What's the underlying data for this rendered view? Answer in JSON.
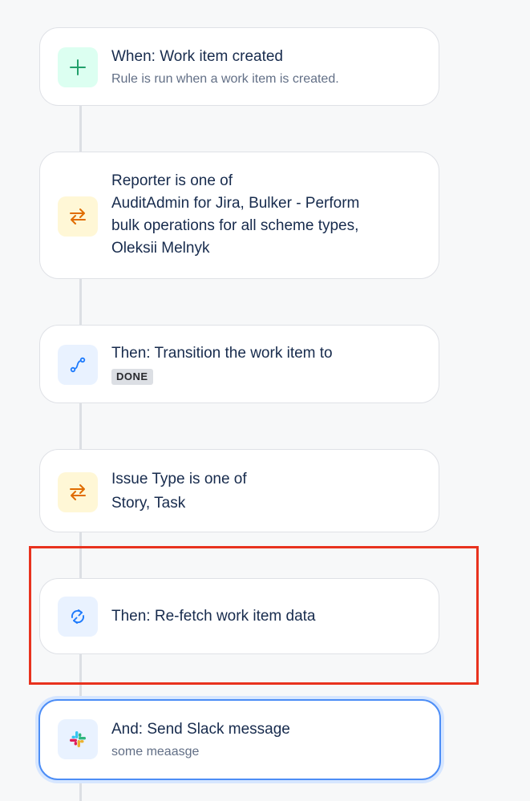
{
  "steps": [
    {
      "kind": "trigger",
      "icon": "plus-icon",
      "title": "When: Work item created",
      "description": "Rule is run when a work item is created."
    },
    {
      "kind": "condition",
      "icon": "condition-arrows-icon",
      "title_lines": [
        "Reporter is one of",
        "AuditAdmin for Jira, Bulker - Perform",
        "bulk operations for all scheme types,",
        "Oleksii Melnyk"
      ]
    },
    {
      "kind": "action",
      "icon": "transition-icon",
      "title": "Then: Transition the work item to",
      "status_lozenge": "DONE"
    },
    {
      "kind": "condition",
      "icon": "condition-arrows-icon",
      "title_lines": [
        "Issue Type is one of",
        "Story, Task"
      ]
    },
    {
      "kind": "action",
      "icon": "refresh-icon",
      "title": "Then: Re-fetch work item data",
      "highlighted": true
    },
    {
      "kind": "action",
      "icon": "slack-icon",
      "title": "And: Send Slack message",
      "description": "some meaasge",
      "selected": true
    }
  ],
  "colors": {
    "trigger_icon": "#22a06b",
    "condition_icon": "#e06c00",
    "action_icon": "#1d7afc",
    "highlight_border": "#e8321e",
    "selected_border": "#4c8df6"
  }
}
